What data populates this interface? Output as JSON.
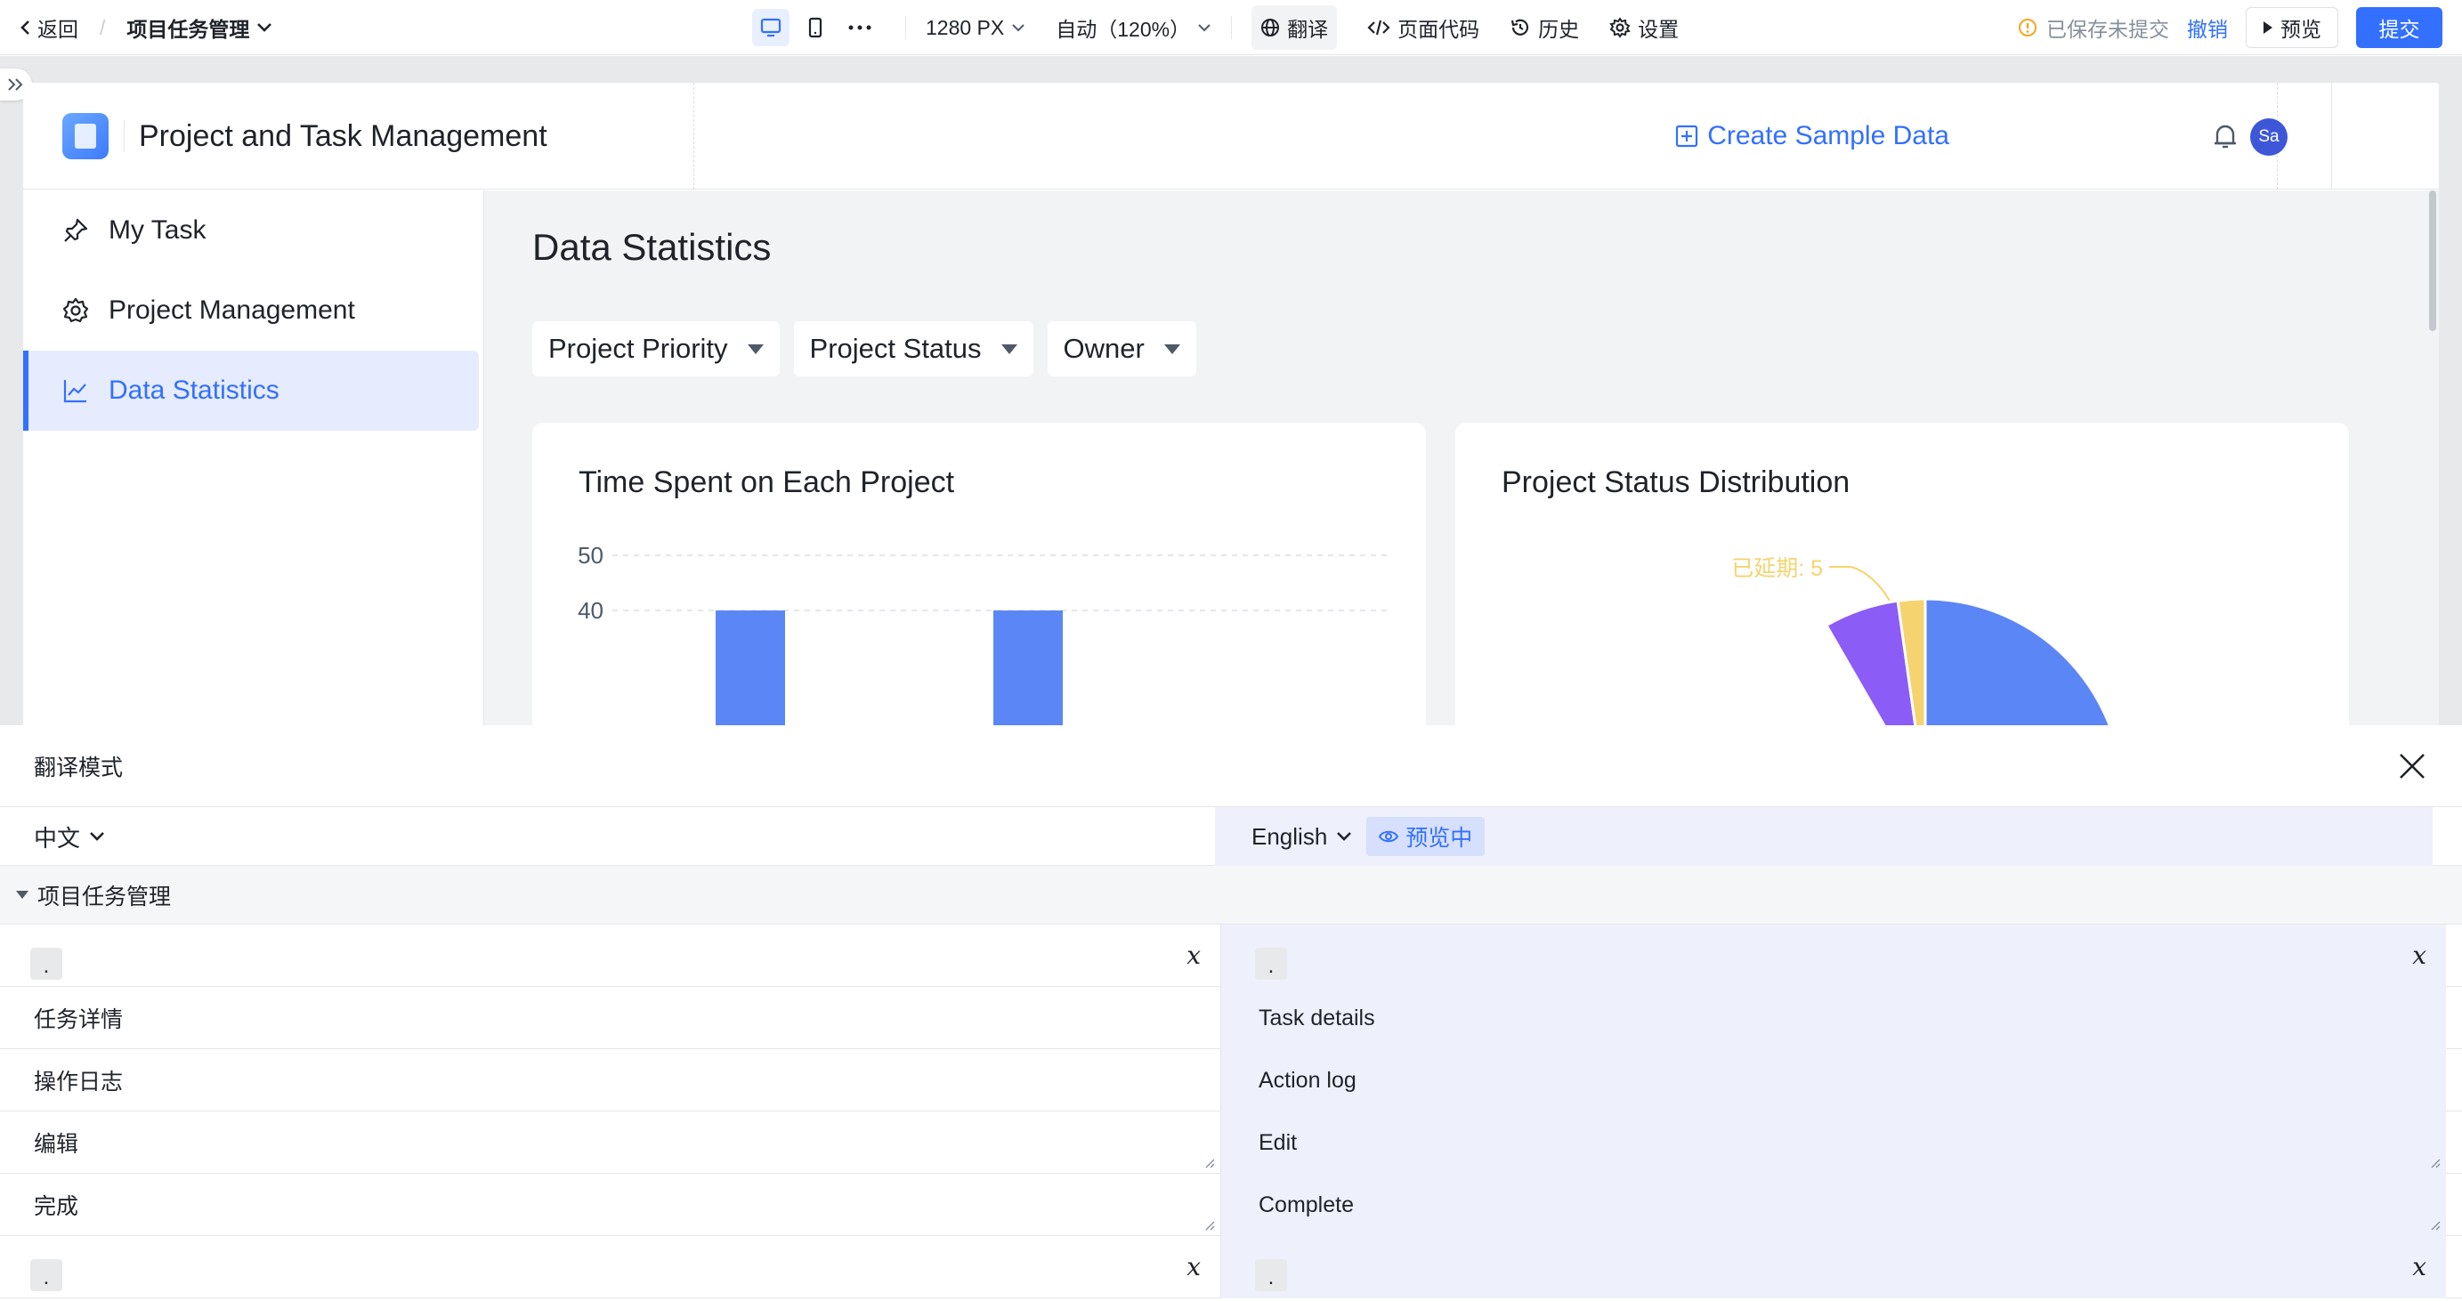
{
  "topbar": {
    "back_label": "返回",
    "breadcrumb_sep": "/",
    "app_name": "项目任务管理",
    "width_value": "1280 PX",
    "zoom_value": "自动（120%）",
    "translate_label": "翻译",
    "page_code_label": "页面代码",
    "history_label": "历史",
    "settings_label": "设置",
    "save_status": "已保存未提交",
    "undo_label": "撤销",
    "preview_label": "预览",
    "submit_label": "提交"
  },
  "app": {
    "title": "Project and Task Management",
    "create_sample_label": "Create Sample Data",
    "avatar_initials": "Sa"
  },
  "sidebar": {
    "items": [
      {
        "label": "My Task",
        "icon": "pin-icon",
        "active": false
      },
      {
        "label": "Project Management",
        "icon": "gear-icon",
        "active": false
      },
      {
        "label": "Data Statistics",
        "icon": "line-chart-icon",
        "active": true
      }
    ]
  },
  "main": {
    "page_title": "Data Statistics",
    "filters": [
      "Project Priority",
      "Project Status",
      "Owner"
    ],
    "cards": [
      {
        "title": "Time Spent on Each Project"
      },
      {
        "title": "Project Status Distribution"
      }
    ]
  },
  "chart_data": [
    {
      "type": "bar",
      "title": "Time Spent on Each Project",
      "yticks": [
        "50",
        "40"
      ],
      "values": [
        40,
        40
      ],
      "color": "#5b86f5"
    },
    {
      "type": "pie",
      "title": "Project Status Distribution",
      "slices": [
        {
          "label": "已延期",
          "value": 5,
          "color": "#f5d470"
        }
      ],
      "annotation": "已延期: 5",
      "other_colors": [
        "#5b86f5",
        "#8b5cf6"
      ]
    }
  ],
  "panel": {
    "title": "翻译模式",
    "source_lang": "中文",
    "target_lang": "English",
    "preview_tag": "预览中",
    "group_name": "项目任务管理",
    "rows": [
      {
        "zh": ".",
        "en": ".",
        "kind": "var"
      },
      {
        "zh": "任务详情",
        "en": "Task details",
        "kind": "text"
      },
      {
        "zh": "操作日志",
        "en": "Action log",
        "kind": "text"
      },
      {
        "zh": "编辑",
        "en": "Edit",
        "kind": "resize"
      },
      {
        "zh": "完成",
        "en": "Complete",
        "kind": "resize"
      },
      {
        "zh": ".",
        "en": ".",
        "kind": "var"
      }
    ],
    "fx_symbol": "x"
  },
  "colors": {
    "accent": "#3370ff",
    "active_bg": "#e6ecfd",
    "translation_bg": "#eef1fc",
    "warning": "#f5a623"
  }
}
